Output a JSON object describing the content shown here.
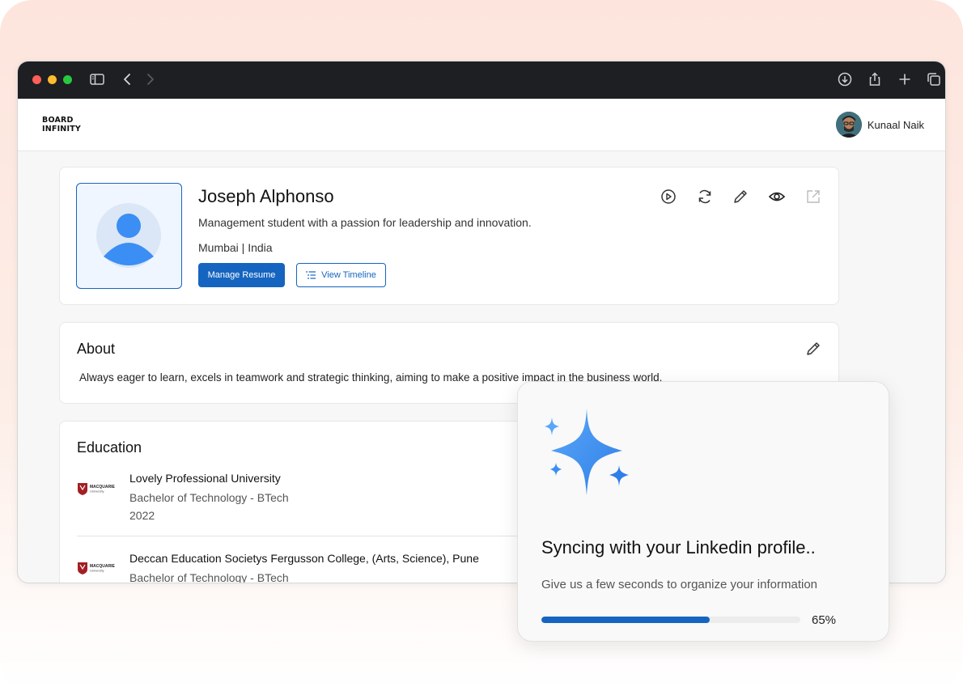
{
  "brand": {
    "logo_line1": "BOARD",
    "logo_line2": "INFINITY"
  },
  "user": {
    "name": "Kunaal Naik"
  },
  "profile": {
    "name": "Joseph Alphonso",
    "tagline": "Management student with a passion for leadership and innovation.",
    "location": "Mumbai | India",
    "manage_resume_label": "Manage Resume",
    "view_timeline_label": "View Timeline"
  },
  "about": {
    "title": "About",
    "text": "Always eager to learn,  excels in teamwork and strategic thinking, aiming to make a positive impact in the business world."
  },
  "education": {
    "title": "Education",
    "logo_text": "MACQUARIE",
    "logo_subtext": "University",
    "items": [
      {
        "institution": "Lovely Professional University",
        "degree": "Bachelor of Technology - BTech",
        "year": "2022"
      },
      {
        "institution": "Deccan Education Societys Fergusson College, (Arts, Science), Pune",
        "degree": "Bachelor of Technology - BTech",
        "year": ""
      }
    ]
  },
  "sync": {
    "title": "Syncing with your Linkedin profile..",
    "subtitle": "Give us a few seconds to organize your information",
    "progress": 0.65,
    "progress_label": "65%"
  },
  "colors": {
    "accent": "#1565c0",
    "titlebar": "#1d1f22",
    "traffic_red": "#fe5f57",
    "traffic_yellow": "#febc2e",
    "traffic_green": "#28c840",
    "sparkle": "#3b8ef3"
  },
  "icons": {
    "titlebar": [
      "sidebar-icon",
      "back-icon",
      "forward-icon",
      "download-icon",
      "share-icon",
      "new-tab-icon",
      "tabs-icon"
    ],
    "profile_actions": [
      "play-icon",
      "sync-icon",
      "edit-icon",
      "eye-icon",
      "external-link-icon"
    ]
  }
}
